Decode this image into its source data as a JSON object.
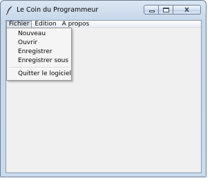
{
  "window": {
    "title": "Le Coin du Programmeur",
    "controls": {
      "minimize": "minimize",
      "maximize": "maximize",
      "close": "x"
    }
  },
  "menubar": {
    "items": [
      {
        "label": "Fichier",
        "active": true
      },
      {
        "label": "Edition",
        "active": false
      },
      {
        "label": "A propos",
        "active": false
      }
    ]
  },
  "file_menu": {
    "items": [
      {
        "label": "Nouveau"
      },
      {
        "label": "Ouvrir"
      },
      {
        "label": "Enregistrer"
      },
      {
        "label": "Enregistrer sous"
      },
      {
        "label": "Quitter le logiciel"
      }
    ]
  },
  "colors": {
    "frame": "#c9dbee",
    "client_background": "#f0f0f0",
    "menu_background": "#f5f5f5"
  }
}
